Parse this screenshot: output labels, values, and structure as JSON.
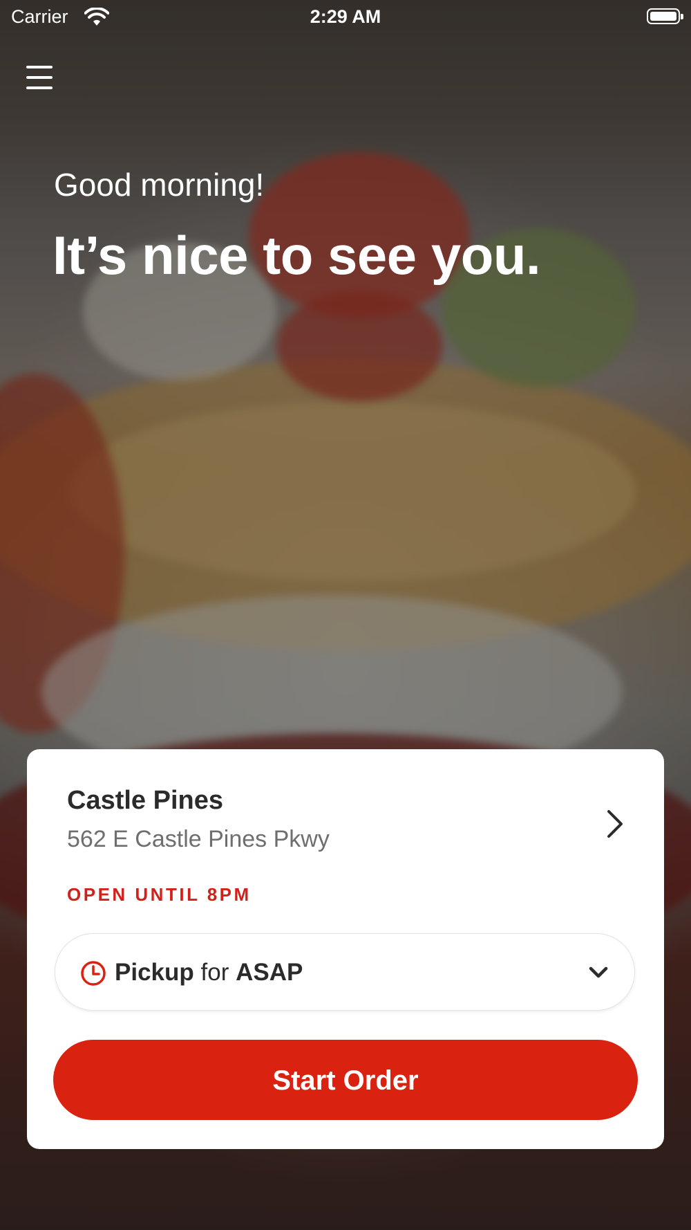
{
  "status_bar": {
    "carrier": "Carrier",
    "time": "2:29 AM",
    "icons": [
      "wifi-icon",
      "battery-icon"
    ]
  },
  "header": {
    "menu_icon": "hamburger-menu-icon"
  },
  "greeting": {
    "subtitle": "Good morning!",
    "title": "It’s nice to see you."
  },
  "location_card": {
    "name": "Castle Pines",
    "address": "562 E Castle Pines Pkwy",
    "hours_status": "OPEN UNTIL 8PM",
    "pickup": {
      "mode": "Pickup",
      "connector": "for",
      "time": "ASAP"
    },
    "start_order_label": "Start Order"
  },
  "colors": {
    "accent_red": "#d9220f",
    "status_red": "#d0221a",
    "card_background": "#ffffff",
    "text_primary": "#2b2b2b",
    "text_secondary": "#6e6e6e"
  }
}
